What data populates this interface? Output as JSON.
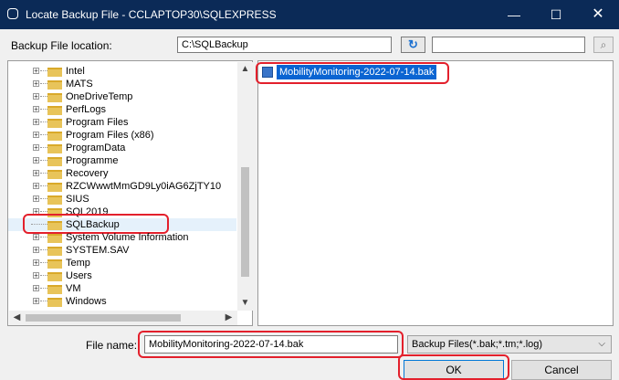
{
  "window": {
    "title": "Locate Backup File - CCLAPTOP30\\SQLEXPRESS",
    "minimize": "—",
    "maximize": "☐",
    "close": "✕"
  },
  "location": {
    "label": "Backup File location:",
    "value": "C:\\SQLBackup",
    "refresh_icon": "refresh-icon",
    "search_value": "",
    "search_icon": "search-icon"
  },
  "tree": {
    "items": [
      {
        "label": "Intel"
      },
      {
        "label": "MATS"
      },
      {
        "label": "OneDriveTemp"
      },
      {
        "label": "PerfLogs"
      },
      {
        "label": "Program Files"
      },
      {
        "label": "Program Files (x86)"
      },
      {
        "label": "ProgramData"
      },
      {
        "label": "Programme"
      },
      {
        "label": "Recovery"
      },
      {
        "label": "RZCWwwtMmGD9Ly0iAG6ZjTY10"
      },
      {
        "label": "SIUS"
      },
      {
        "label": "SQL2019"
      },
      {
        "label": "SQLBackup",
        "selected": true
      },
      {
        "label": "System Volume Information"
      },
      {
        "label": "SYSTEM.SAV"
      },
      {
        "label": "Temp"
      },
      {
        "label": "Users"
      },
      {
        "label": "VM"
      },
      {
        "label": "Windows"
      }
    ]
  },
  "files": {
    "items": [
      {
        "label": "MobilityMonitoring-2022-07-14.bak",
        "selected": true
      }
    ]
  },
  "filename": {
    "label": "File name:",
    "value": "MobilityMonitoring-2022-07-14.bak"
  },
  "filter": {
    "selected": "Backup Files(*.bak;*.tm;*.log)"
  },
  "buttons": {
    "ok": "OK",
    "cancel": "Cancel"
  },
  "colors": {
    "titlebar": "#0b2a57",
    "selection": "#0a64d2",
    "highlight": "#e3202c"
  }
}
